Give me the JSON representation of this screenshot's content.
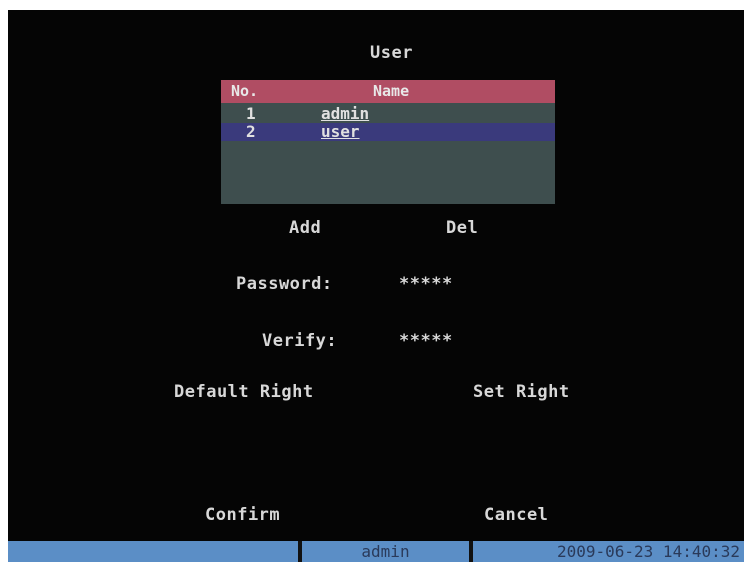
{
  "title": "User",
  "user_table": {
    "headers": {
      "no": "No.",
      "name": "Name"
    },
    "rows": [
      {
        "no": "1",
        "name": "admin"
      },
      {
        "no": "2",
        "name": "user"
      }
    ]
  },
  "buttons": {
    "add": "Add",
    "del": "Del",
    "default_right": "Default Right",
    "set_right": "Set Right",
    "confirm": "Confirm",
    "cancel": "Cancel"
  },
  "password": {
    "label": "Password:",
    "value": "*****"
  },
  "verify": {
    "label": "Verify:",
    "value": "*****"
  },
  "status_bar": {
    "user": "admin",
    "datetime": "2009-06-23 14:40:32"
  },
  "colors": {
    "header": "#b04d63",
    "table_bg": "#3e4e4e",
    "selected_row": "#3a3a7c",
    "status_bar": "#5b8ec6"
  }
}
